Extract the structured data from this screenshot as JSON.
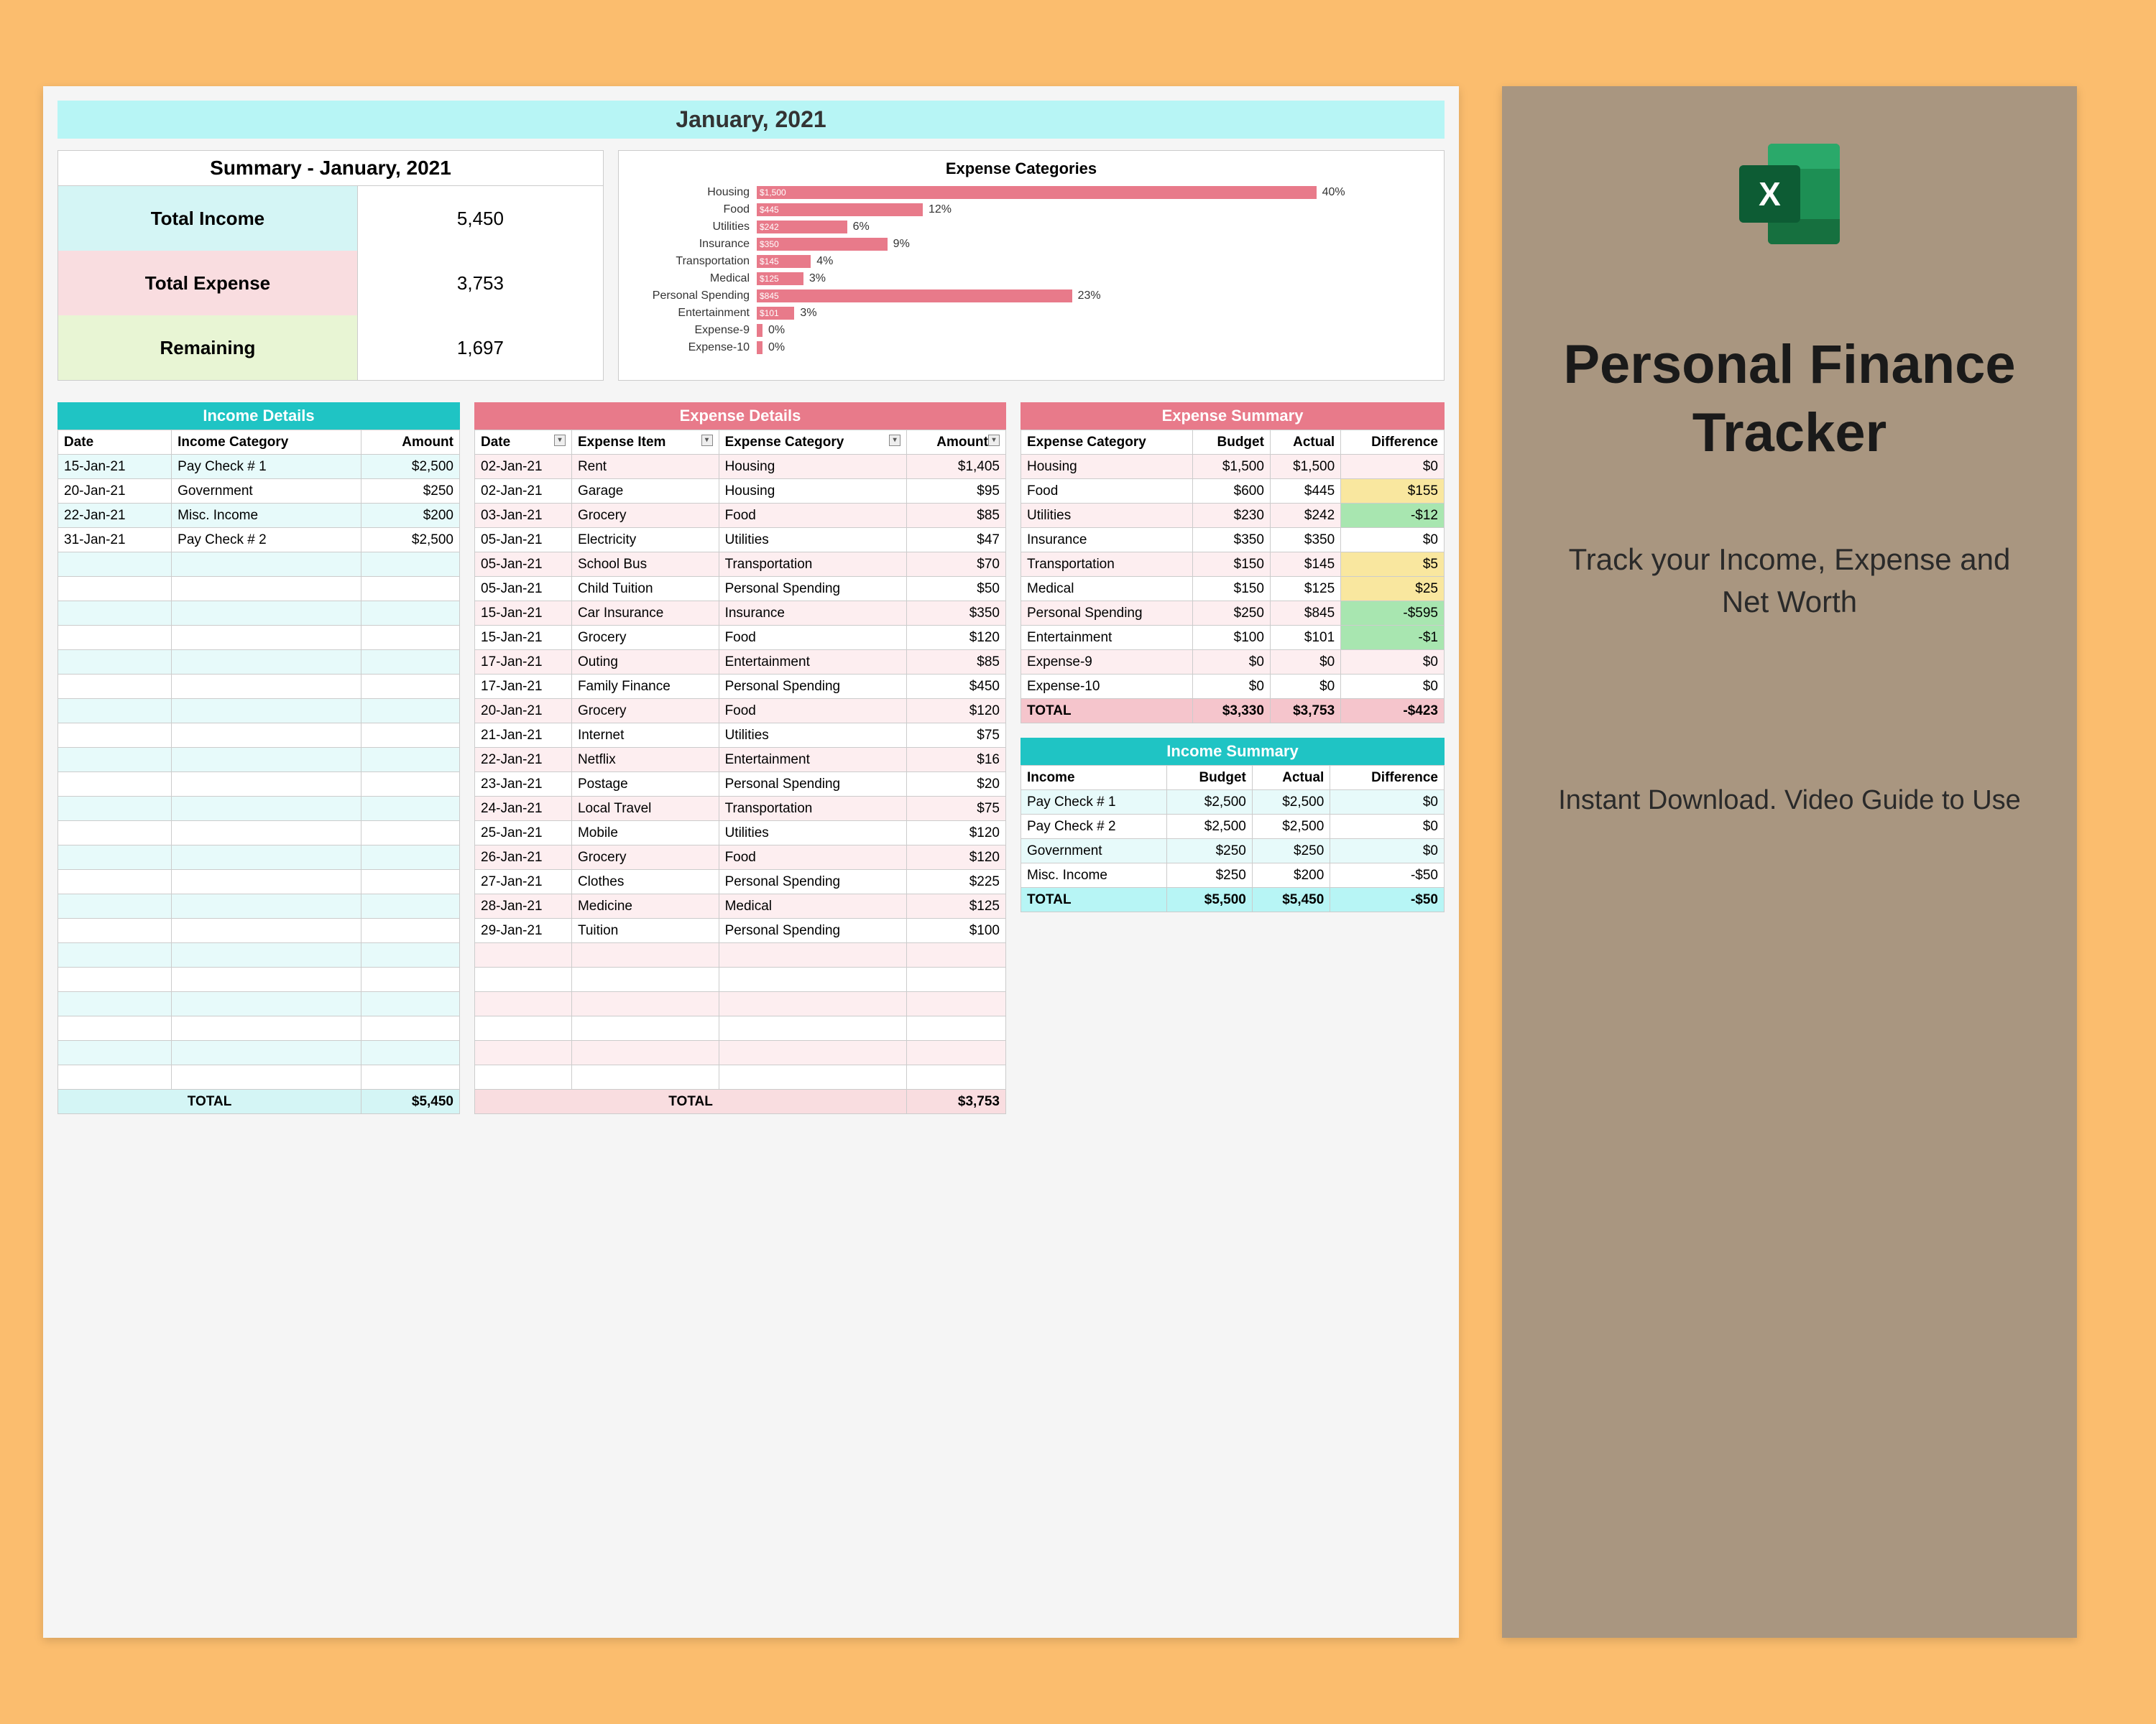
{
  "month_title": "January, 2021",
  "summary": {
    "title": "Summary - January, 2021",
    "income_label": "Total Income",
    "income_value": "5,450",
    "expense_label": "Total Expense",
    "expense_value": "3,753",
    "remaining_label": "Remaining",
    "remaining_value": "1,697"
  },
  "chart_data": {
    "type": "bar",
    "title": "Expense Categories",
    "categories": [
      "Housing",
      "Food",
      "Utilities",
      "Insurance",
      "Transportation",
      "Medical",
      "Personal Spending",
      "Entertainment",
      "Expense-9",
      "Expense-10"
    ],
    "values": [
      1500,
      445,
      242,
      350,
      145,
      125,
      845,
      101,
      0,
      0
    ],
    "percentages": [
      "40%",
      "12%",
      "6%",
      "9%",
      "4%",
      "3%",
      "23%",
      "3%",
      "0%",
      "0%"
    ],
    "bar_labels": [
      "$1,500",
      "$445",
      "$242",
      "$350",
      "$145",
      "$125",
      "$845",
      "$101",
      "",
      ""
    ],
    "max": 1500
  },
  "income_details": {
    "title": "Income Details",
    "headers": [
      "Date",
      "Income Category",
      "Amount"
    ],
    "rows": [
      [
        "15-Jan-21",
        "Pay Check # 1",
        "$2,500"
      ],
      [
        "20-Jan-21",
        "Government",
        "$250"
      ],
      [
        "22-Jan-21",
        "Misc. Income",
        "$200"
      ],
      [
        "31-Jan-21",
        "Pay Check # 2",
        "$2,500"
      ]
    ],
    "empty_rows": 22,
    "total_label": "TOTAL",
    "total_value": "$5,450"
  },
  "expense_details": {
    "title": "Expense Details",
    "headers": [
      "Date",
      "Expense Item",
      "Expense Category",
      "Amount"
    ],
    "rows": [
      [
        "02-Jan-21",
        "Rent",
        "Housing",
        "$1,405"
      ],
      [
        "02-Jan-21",
        "Garage",
        "Housing",
        "$95"
      ],
      [
        "03-Jan-21",
        "Grocery",
        "Food",
        "$85"
      ],
      [
        "05-Jan-21",
        "Electricity",
        "Utilities",
        "$47"
      ],
      [
        "05-Jan-21",
        "School Bus",
        "Transportation",
        "$70"
      ],
      [
        "05-Jan-21",
        "Child Tuition",
        "Personal Spending",
        "$50"
      ],
      [
        "15-Jan-21",
        "Car Insurance",
        "Insurance",
        "$350"
      ],
      [
        "15-Jan-21",
        "Grocery",
        "Food",
        "$120"
      ],
      [
        "17-Jan-21",
        "Outing",
        "Entertainment",
        "$85"
      ],
      [
        "17-Jan-21",
        "Family Finance",
        "Personal Spending",
        "$450"
      ],
      [
        "20-Jan-21",
        "Grocery",
        "Food",
        "$120"
      ],
      [
        "21-Jan-21",
        "Internet",
        "Utilities",
        "$75"
      ],
      [
        "22-Jan-21",
        "Netflix",
        "Entertainment",
        "$16"
      ],
      [
        "23-Jan-21",
        "Postage",
        "Personal Spending",
        "$20"
      ],
      [
        "24-Jan-21",
        "Local Travel",
        "Transportation",
        "$75"
      ],
      [
        "25-Jan-21",
        "Mobile",
        "Utilities",
        "$120"
      ],
      [
        "26-Jan-21",
        "Grocery",
        "Food",
        "$120"
      ],
      [
        "27-Jan-21",
        "Clothes",
        "Personal Spending",
        "$225"
      ],
      [
        "28-Jan-21",
        "Medicine",
        "Medical",
        "$125"
      ],
      [
        "29-Jan-21",
        "Tuition",
        "Personal Spending",
        "$100"
      ]
    ],
    "empty_rows": 6,
    "total_label": "TOTAL",
    "total_value": "$3,753"
  },
  "expense_summary": {
    "title": "Expense Summary",
    "headers": [
      "Expense Category",
      "Budget",
      "Actual",
      "Difference"
    ],
    "rows": [
      {
        "c": [
          "Housing",
          "$1,500",
          "$1,500",
          "$0"
        ],
        "d": ""
      },
      {
        "c": [
          "Food",
          "$600",
          "$445",
          "$155"
        ],
        "d": "pos"
      },
      {
        "c": [
          "Utilities",
          "$230",
          "$242",
          "-$12"
        ],
        "d": "neg"
      },
      {
        "c": [
          "Insurance",
          "$350",
          "$350",
          "$0"
        ],
        "d": ""
      },
      {
        "c": [
          "Transportation",
          "$150",
          "$145",
          "$5"
        ],
        "d": "pos"
      },
      {
        "c": [
          "Medical",
          "$150",
          "$125",
          "$25"
        ],
        "d": "pos"
      },
      {
        "c": [
          "Personal Spending",
          "$250",
          "$845",
          "-$595"
        ],
        "d": "neg"
      },
      {
        "c": [
          "Entertainment",
          "$100",
          "$101",
          "-$1"
        ],
        "d": "neg"
      },
      {
        "c": [
          "Expense-9",
          "$0",
          "$0",
          "$0"
        ],
        "d": ""
      },
      {
        "c": [
          "Expense-10",
          "$0",
          "$0",
          "$0"
        ],
        "d": ""
      }
    ],
    "total": [
      "TOTAL",
      "$3,330",
      "$3,753",
      "-$423"
    ]
  },
  "income_summary": {
    "title": "Income Summary",
    "headers": [
      "Income",
      "Budget",
      "Actual",
      "Difference"
    ],
    "rows": [
      [
        "Pay Check # 1",
        "$2,500",
        "$2,500",
        "$0"
      ],
      [
        "Pay Check # 2",
        "$2,500",
        "$2,500",
        "$0"
      ],
      [
        "Government",
        "$250",
        "$250",
        "$0"
      ],
      [
        "Misc. Income",
        "$250",
        "$200",
        "-$50"
      ]
    ],
    "total": [
      "TOTAL",
      "$5,500",
      "$5,450",
      "-$50"
    ]
  },
  "sidebar": {
    "title": "Personal Finance Tracker",
    "sub1": "Track your Income, Expense and Net Worth",
    "sub2": "Instant Download. Video Guide to Use"
  }
}
